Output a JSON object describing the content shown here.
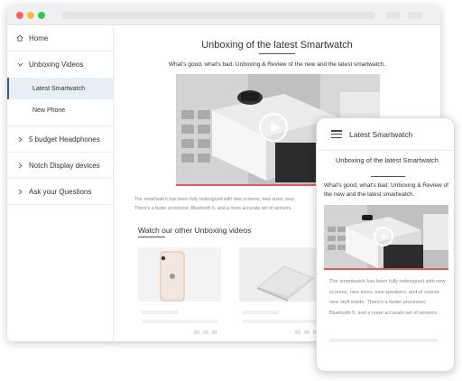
{
  "sidebar": {
    "items": [
      {
        "label": "Home",
        "icon": "home-icon"
      },
      {
        "label": "Unboxing Videos",
        "icon": "chevron-down-icon",
        "children": [
          {
            "label": "Latest Smartwatch",
            "active": true
          },
          {
            "label": "New Phone",
            "active": false
          }
        ]
      },
      {
        "label": "5 budget Headphones",
        "icon": "chevron-right-icon"
      },
      {
        "label": "Notch Display devices",
        "icon": "chevron-right-icon"
      },
      {
        "label": "Ask your Questions",
        "icon": "chevron-right-icon"
      }
    ]
  },
  "main": {
    "title": "Unboxing of the latest Smartwatch",
    "subtitle": "What's good, what's bad: Unboxing & Review of the new and the latest smartwatch.",
    "body_line1": "The smartwatch has been fully redesigned with new screens, new sizes, new",
    "body_line2": "There's a faster processor, Bluetooth 5, and a more accurate set of sensors.",
    "section_title": "Watch our other Unboxing videos"
  },
  "mobile": {
    "header_title": "Latest Smartwatch",
    "title": "Unboxing of the latest Smartwatch",
    "subtitle": "What's good, what's bad: Unboxing & Review of the new and the latest smartwatch.",
    "body": "The smartwatch has been fully redesigned with new screens, new sizes, new speakers, and of course new stuff inside. There's a faster processor, Bluetooth 5, and a more accurate set of sensors."
  },
  "colors": {
    "accent": "#3d5a8c",
    "active_bg": "#e9eff7",
    "progress": "#e05b5b",
    "dot_red": "#fc605c",
    "dot_yellow": "#fdbc40",
    "dot_green": "#34c84a"
  }
}
